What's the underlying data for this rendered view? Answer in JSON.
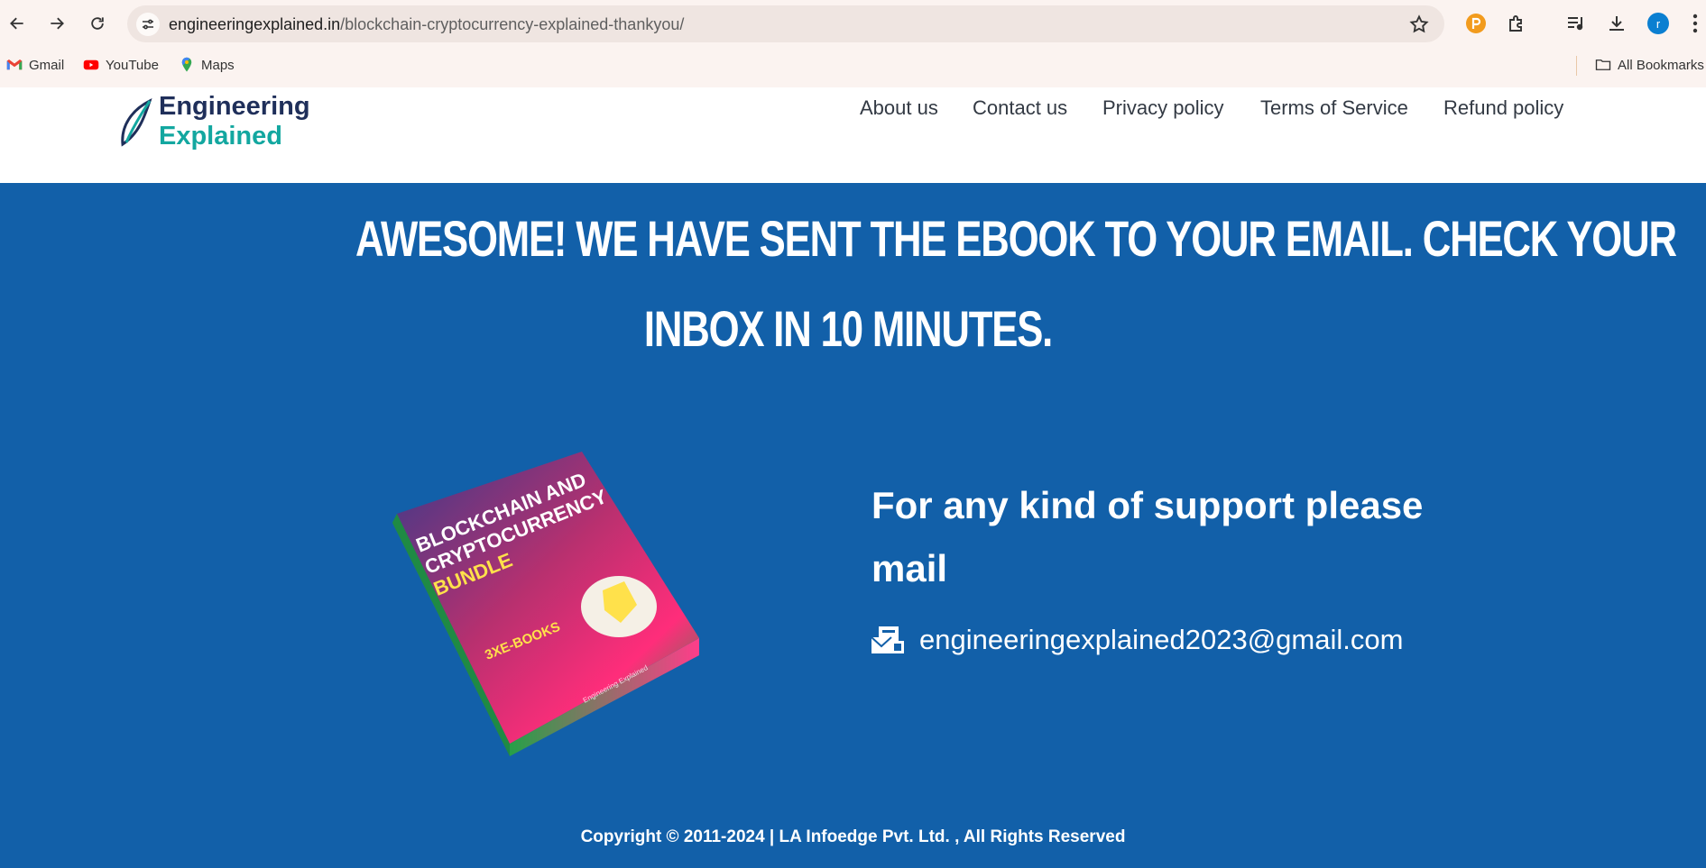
{
  "browser": {
    "url_domain": "engineeringexplained.in",
    "url_path": "/blockchain-cryptocurrency-explained-thankyou/",
    "profile_initial": "r",
    "bookmarks": [
      {
        "label": "Gmail",
        "icon": "gmail-icon"
      },
      {
        "label": "YouTube",
        "icon": "youtube-icon"
      },
      {
        "label": "Maps",
        "icon": "maps-icon"
      }
    ],
    "all_bookmarks_label": "All Bookmarks"
  },
  "site": {
    "logo": {
      "line1": "Engineering",
      "line2": "Explained"
    },
    "menu": [
      {
        "label": "About us"
      },
      {
        "label": "Contact us"
      },
      {
        "label": "Privacy policy"
      },
      {
        "label": "Terms of Service"
      },
      {
        "label": "Refund policy"
      }
    ]
  },
  "hero": {
    "title_line1": "AWESOME! WE HAVE SENT THE EBOOK TO YOUR EMAIL. CHECK YOUR",
    "title_line2": "INBOX IN 10 MINUTES."
  },
  "ebook": {
    "title_line1": "BLOCKCHAIN AND",
    "title_line2": "CRYPTOCURRENCY",
    "title_line3": "BUNDLE",
    "count_label": "3XE-BOOKS",
    "brand": "Engineering Explained"
  },
  "support": {
    "heading": "For any kind of support please mail",
    "email": "engineeringexplained2023@gmail.com"
  },
  "footer": {
    "copyright": "Copyright © 2011-2024 | LA Infoedge Pvt. Ltd. , All Rights Reserved"
  },
  "colors": {
    "hero_background": "#1260a9",
    "logo_dark": "#1f2f5a",
    "logo_teal": "#13a7a0",
    "ebook_gradient_pink": "#ff2d7a",
    "ebook_gradient_green": "#1f9a4a",
    "ebook_title_yellow": "#ffe14b"
  }
}
